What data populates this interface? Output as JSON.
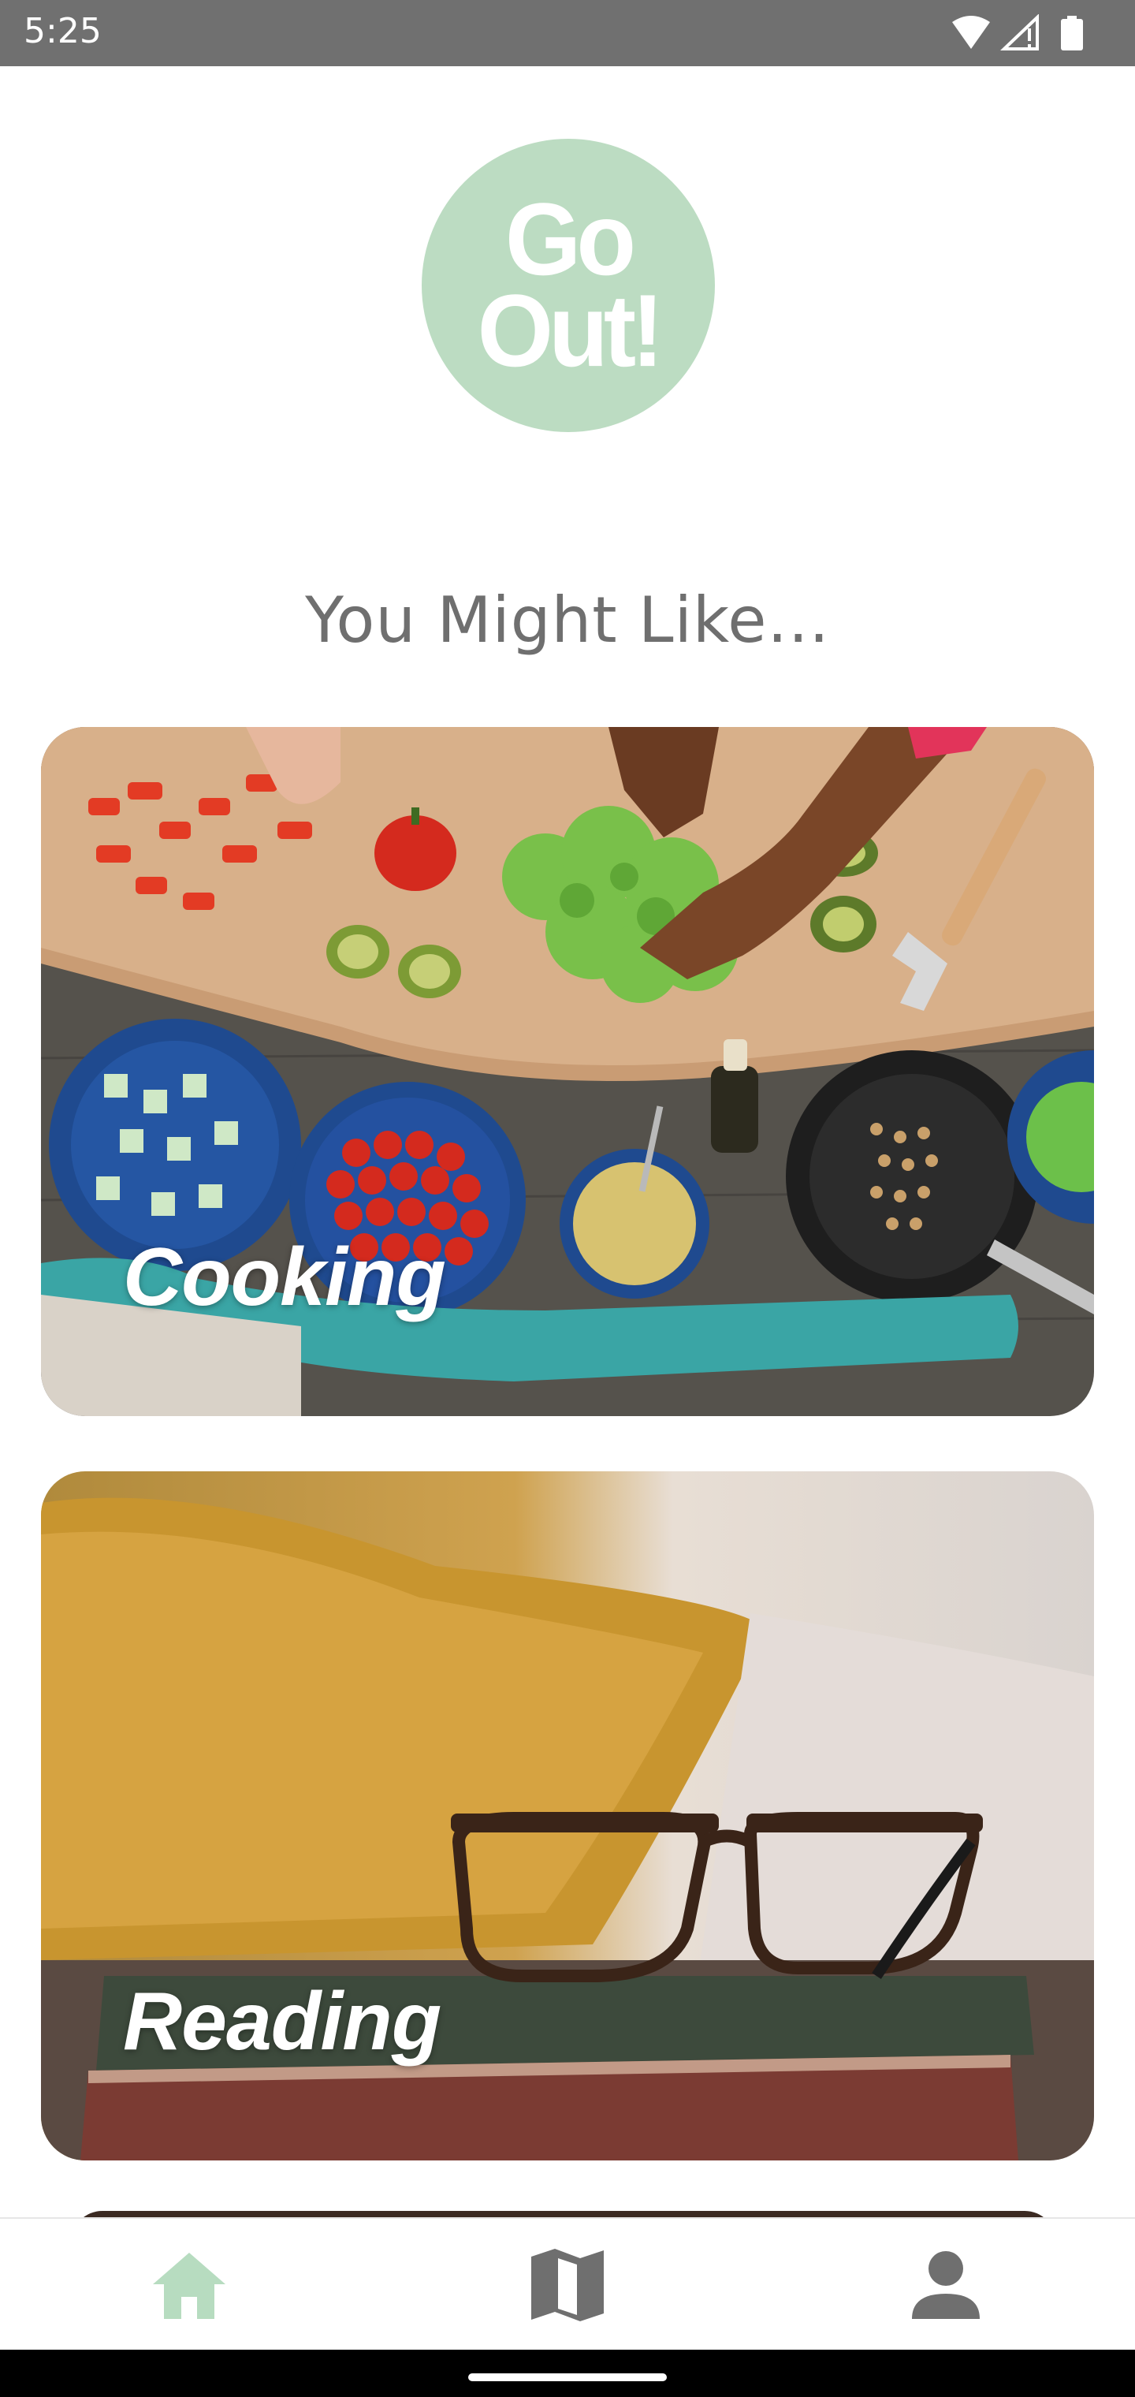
{
  "status_bar": {
    "time": "5:25",
    "icons": [
      "wifi-icon",
      "signal-icon",
      "battery-icon"
    ]
  },
  "logo": {
    "line1": "Go",
    "line2": "Out!",
    "color": "#bcdcc2"
  },
  "section": {
    "heading": "You Might Like..."
  },
  "cards": [
    {
      "label": "Cooking",
      "image": "cooking-photo"
    },
    {
      "label": "Reading",
      "image": "reading-photo"
    }
  ],
  "bottom_nav": {
    "items": [
      {
        "icon": "home-icon",
        "active": true
      },
      {
        "icon": "map-icon",
        "active": false
      },
      {
        "icon": "profile-icon",
        "active": false
      }
    ],
    "active_color": "#b7dcc0",
    "inactive_color": "#6f6f6f"
  }
}
